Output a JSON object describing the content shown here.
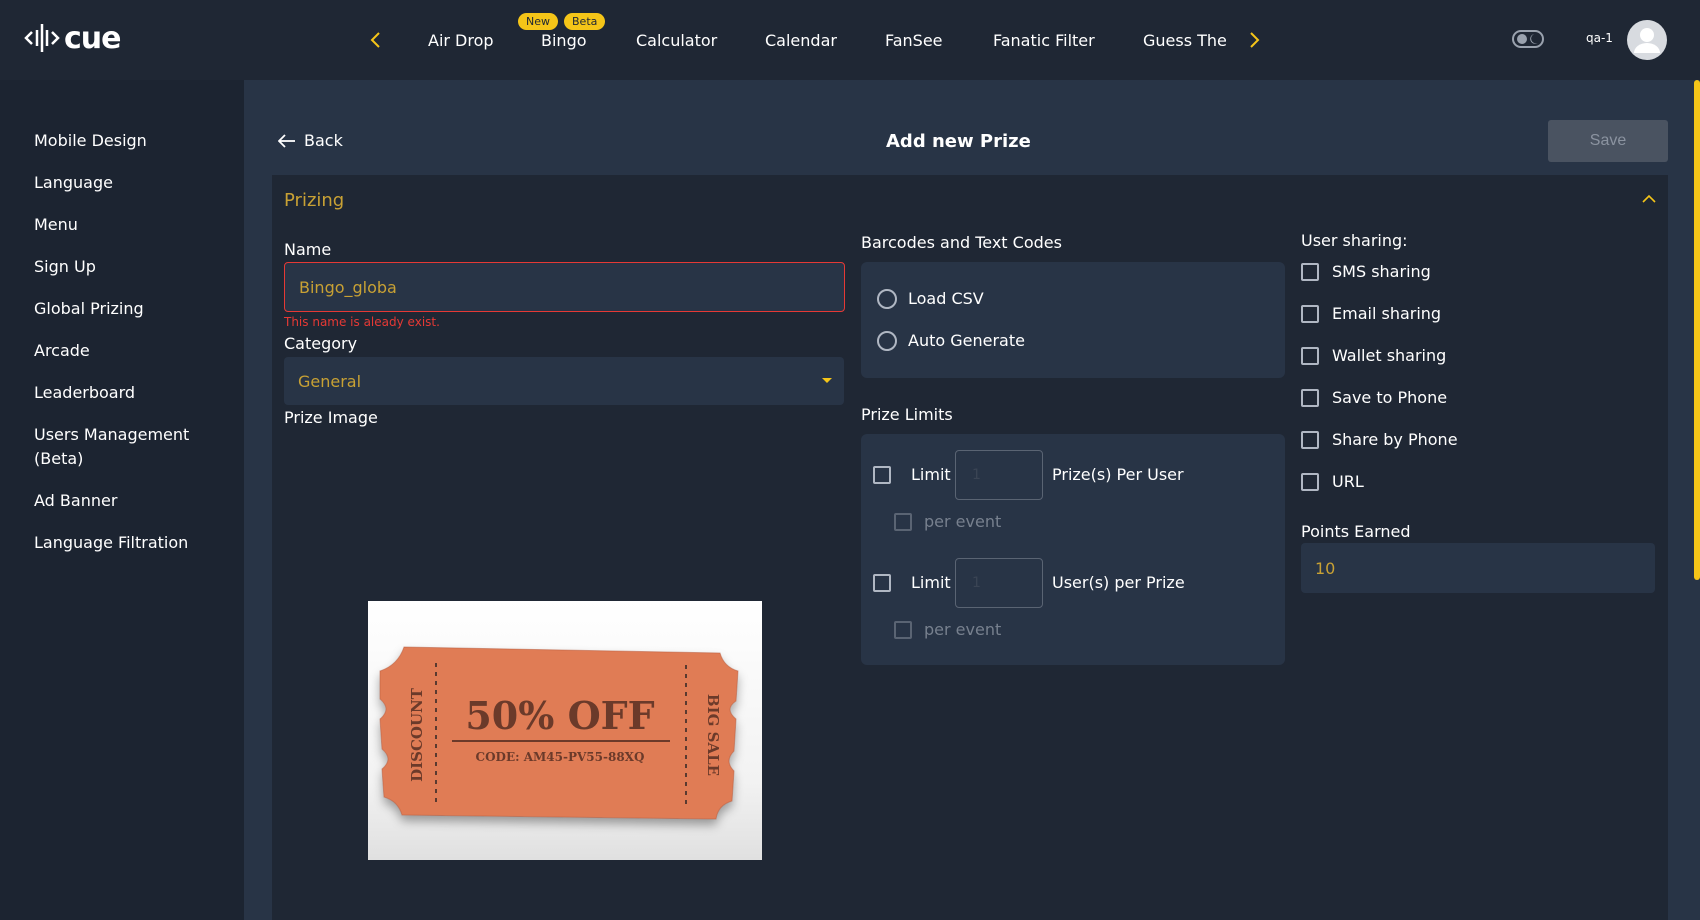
{
  "app": {
    "logo_text": "cue",
    "user": "qa-1"
  },
  "nav": {
    "items": [
      "Air Drop",
      "Bingo",
      "Calculator",
      "Calendar",
      "FanSee",
      "Fanatic Filter",
      "Guess The"
    ],
    "badges": {
      "new": "New",
      "beta": "Beta"
    },
    "accent": "#f5c518"
  },
  "sidebar": {
    "items": [
      "Mobile Design",
      "Language",
      "Menu",
      "Sign Up",
      "Global Prizing",
      "Arcade",
      "Leaderboard",
      "Users Management",
      "(Beta)",
      "Ad Banner",
      "Language Filtration"
    ]
  },
  "header": {
    "back_label": "Back",
    "title": "Add new Prize",
    "save_label": "Save"
  },
  "prizing": {
    "section_title": "Prizing",
    "name_label": "Name",
    "name_value": "Bingo_globa",
    "name_error": "This name is aleady exist.",
    "category_label": "Category",
    "category_value": "General",
    "image_label": "Prize Image",
    "image_text": {
      "main": "50% OFF",
      "code": "CODE: AM45-PV55-88XQ",
      "left": "DISCOUNT",
      "right": "BIG SALE"
    }
  },
  "codes": {
    "label": "Barcodes and Text Codes",
    "options": [
      "Load CSV",
      "Auto Generate"
    ]
  },
  "limits": {
    "label": "Prize Limits",
    "limit_label": "Limit",
    "per_user_value": "1",
    "per_user_label": "Prize(s) Per User",
    "per_prize_value": "1",
    "per_prize_label": "User(s) per Prize",
    "per_event_label": "per event"
  },
  "sharing": {
    "label": "User sharing:",
    "options": [
      "SMS sharing",
      "Email sharing",
      "Wallet sharing",
      "Save to Phone",
      "Share by Phone",
      "URL"
    ],
    "points_label": "Points Earned",
    "points_value": "10"
  }
}
